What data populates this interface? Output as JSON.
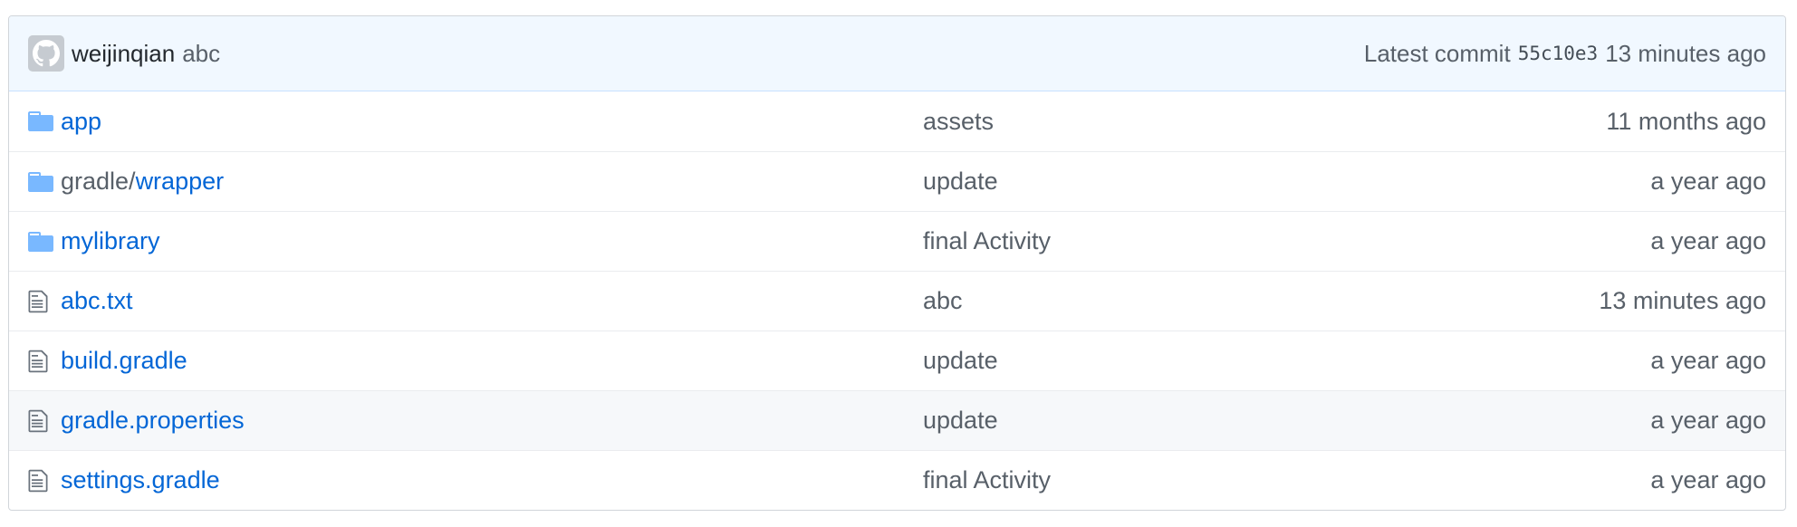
{
  "latest_commit": {
    "author": "weijinqian",
    "message": "abc",
    "label": "Latest commit",
    "sha": "55c10e3",
    "age": "13 minutes ago",
    "avatar_icon": "github-octocat-icon"
  },
  "files": [
    {
      "type": "directory",
      "icon": "folder-icon",
      "prefix": "",
      "name": "app",
      "message": "assets",
      "age": "11 months ago"
    },
    {
      "type": "directory",
      "icon": "folder-icon",
      "prefix": "gradle/",
      "name": "wrapper",
      "message": "update",
      "age": "a year ago"
    },
    {
      "type": "directory",
      "icon": "folder-icon",
      "prefix": "",
      "name": "mylibrary",
      "message": "final Activity",
      "age": "a year ago"
    },
    {
      "type": "file",
      "icon": "file-text-icon",
      "prefix": "",
      "name": "abc.txt",
      "message": "abc",
      "age": "13 minutes ago"
    },
    {
      "type": "file",
      "icon": "file-text-icon",
      "prefix": "",
      "name": "build.gradle",
      "message": "update",
      "age": "a year ago"
    },
    {
      "type": "file",
      "icon": "file-text-icon",
      "prefix": "",
      "name": "gradle.properties",
      "message": "update",
      "age": "a year ago"
    },
    {
      "type": "file",
      "icon": "file-text-icon",
      "prefix": "",
      "name": "settings.gradle",
      "message": "final Activity",
      "age": "a year ago"
    }
  ],
  "colors": {
    "link": "#0366d6",
    "muted": "#586069",
    "commit_bar_bg": "#f1f8ff",
    "folder_icon": "#79b8ff"
  }
}
